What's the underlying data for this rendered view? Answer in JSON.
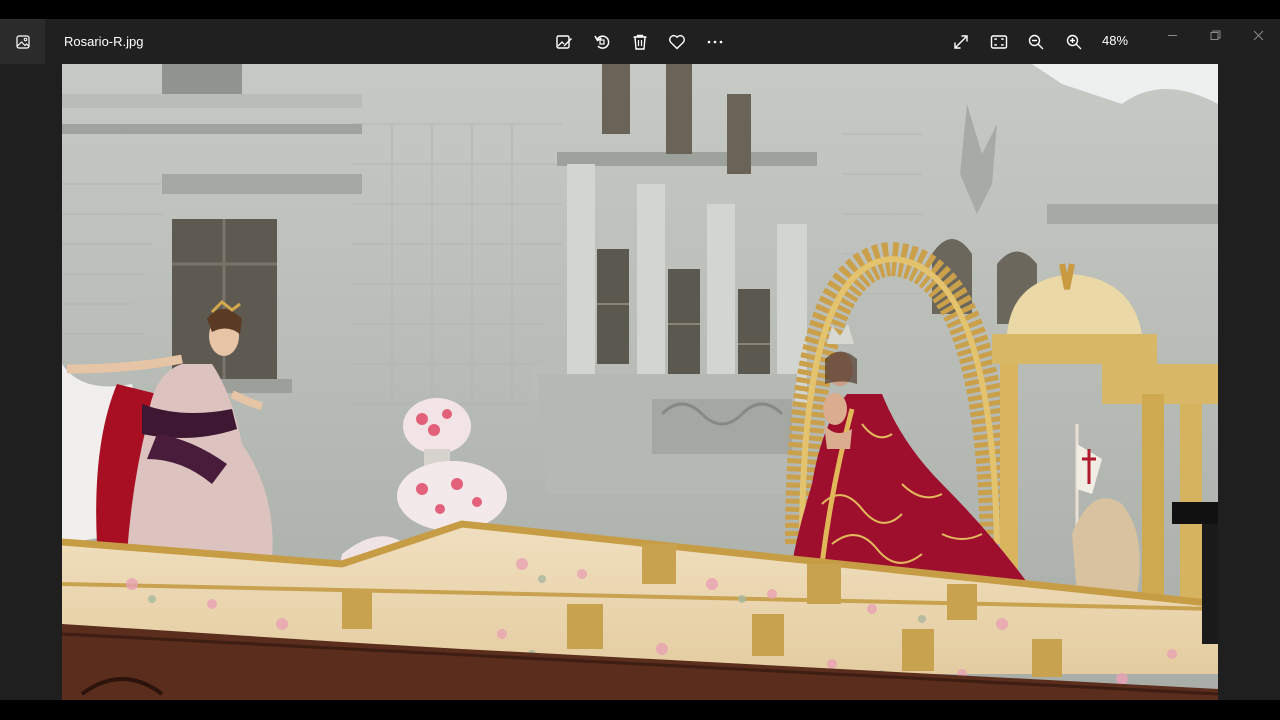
{
  "app": {
    "file_name": "Rosario-R.jpg",
    "zoom_level": "48%"
  },
  "toolbar": {
    "icons": [
      "edit-image-icon",
      "rotate-icon",
      "delete-icon",
      "favorite-icon",
      "more-icon"
    ]
  },
  "view_controls": {
    "icons": [
      "fullscreen-icon",
      "actual-size-icon",
      "zoom-out-icon",
      "zoom-in-icon"
    ]
  },
  "window_controls": {
    "icons": [
      "minimize-icon",
      "maximize-icon",
      "close-icon"
    ]
  },
  "colors": {
    "titlebar_bg": "#202020",
    "viewer_bg": "#1f1f1f",
    "building_stone": "#c9ccc7",
    "robe_crimson": "#9e0f2e",
    "gold_trim": "#d9b45a",
    "platform_cream": "#ecd9b4"
  }
}
